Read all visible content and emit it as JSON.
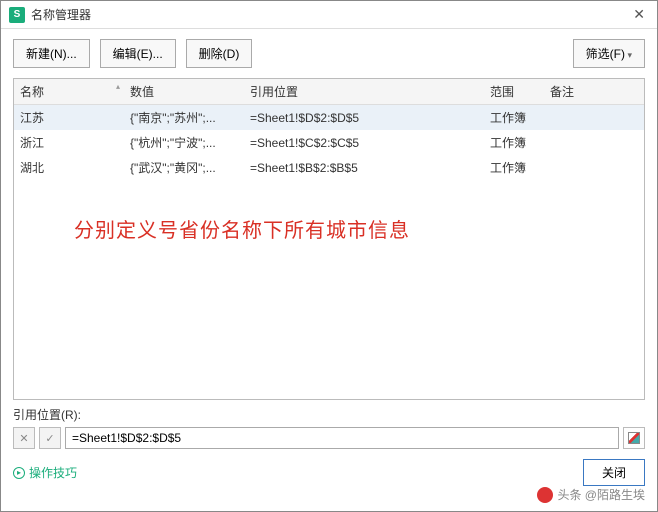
{
  "window": {
    "title": "名称管理器"
  },
  "toolbar": {
    "new_label": "新建(N)...",
    "edit_label": "编辑(E)...",
    "delete_label": "删除(D)",
    "filter_label": "筛选(F)"
  },
  "grid": {
    "cols": {
      "name": "名称",
      "value": "数值",
      "ref": "引用位置",
      "scope": "范围",
      "note": "备注"
    },
    "rows": [
      {
        "name": "江苏",
        "value": "{\"南京\";\"苏州\";...",
        "ref": "=Sheet1!$D$2:$D$5",
        "scope": "工作簿",
        "note": ""
      },
      {
        "name": "浙江",
        "value": "{\"杭州\";\"宁波\";...",
        "ref": "=Sheet1!$C$2:$C$5",
        "scope": "工作簿",
        "note": ""
      },
      {
        "name": "湖北",
        "value": "{\"武汉\";\"黄冈\";...",
        "ref": "=Sheet1!$B$2:$B$5",
        "scope": "工作簿",
        "note": ""
      }
    ]
  },
  "annotation": "分别定义号省份名称下所有城市信息",
  "refsection": {
    "label": "引用位置(R):",
    "value": "=Sheet1!$D$2:$D$5"
  },
  "footer": {
    "tips": "操作技巧",
    "close": "关闭"
  },
  "watermark": "头条 @陌路生埃"
}
